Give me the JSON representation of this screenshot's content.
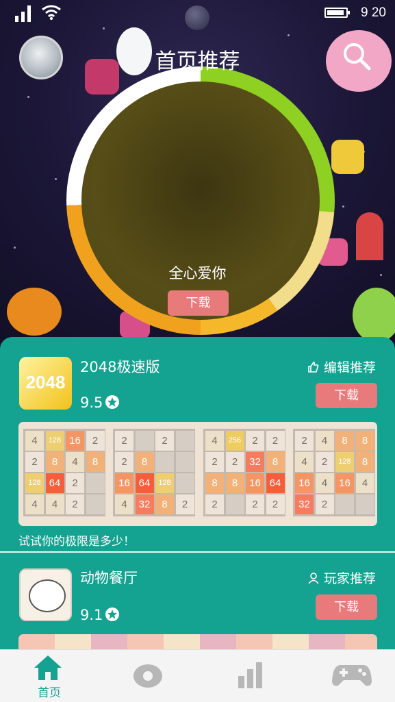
{
  "status_bar": {
    "time": "9 20"
  },
  "header": {
    "title": "首页推荐"
  },
  "hero": {
    "title": "全心爱你",
    "button": "下载"
  },
  "apps": [
    {
      "name": "2048极速版",
      "rating": "9.5",
      "tag": "编辑推荐",
      "button": "下载",
      "description": "试试你的极限是多少！",
      "boards": [
        [
          [
            "4",
            "128",
            "16",
            "2"
          ],
          [
            "2",
            "8",
            "4",
            "8"
          ],
          [
            "128",
            "64",
            "2",
            ""
          ],
          [
            "4",
            "4",
            "2",
            ""
          ]
        ],
        [
          [
            "2",
            "",
            "2",
            ""
          ],
          [
            "2",
            "8",
            "",
            ""
          ],
          [
            "16",
            "64",
            "128",
            ""
          ],
          [
            "4",
            "32",
            "8",
            "2"
          ]
        ],
        [
          [
            "4",
            "256",
            "2",
            "2"
          ],
          [
            "2",
            "2",
            "32",
            "8"
          ],
          [
            "8",
            "8",
            "16",
            "64"
          ],
          [
            "2",
            "",
            "2",
            "2"
          ]
        ],
        [
          [
            "2",
            "4",
            "8",
            "8"
          ],
          [
            "4",
            "2",
            "128",
            "8"
          ],
          [
            "16",
            "4",
            "16",
            "4"
          ],
          [
            "32",
            "2",
            "",
            ""
          ]
        ]
      ]
    },
    {
      "name": "动物餐厅",
      "rating": "9.1",
      "tag": "玩家推荐",
      "button": "下载"
    }
  ],
  "tabbar": {
    "items": [
      {
        "label": "首页",
        "icon": "home-icon",
        "active": true
      },
      {
        "label": "",
        "icon": "eye-icon",
        "active": false
      },
      {
        "label": "",
        "icon": "bar-chart-icon",
        "active": false
      },
      {
        "label": "",
        "icon": "gamepad-icon",
        "active": false
      }
    ]
  },
  "colors": {
    "accent": "#14a291",
    "button": "#e87a7b",
    "planet_green": "#8fd122",
    "planet_orange": "#f0a21e"
  }
}
